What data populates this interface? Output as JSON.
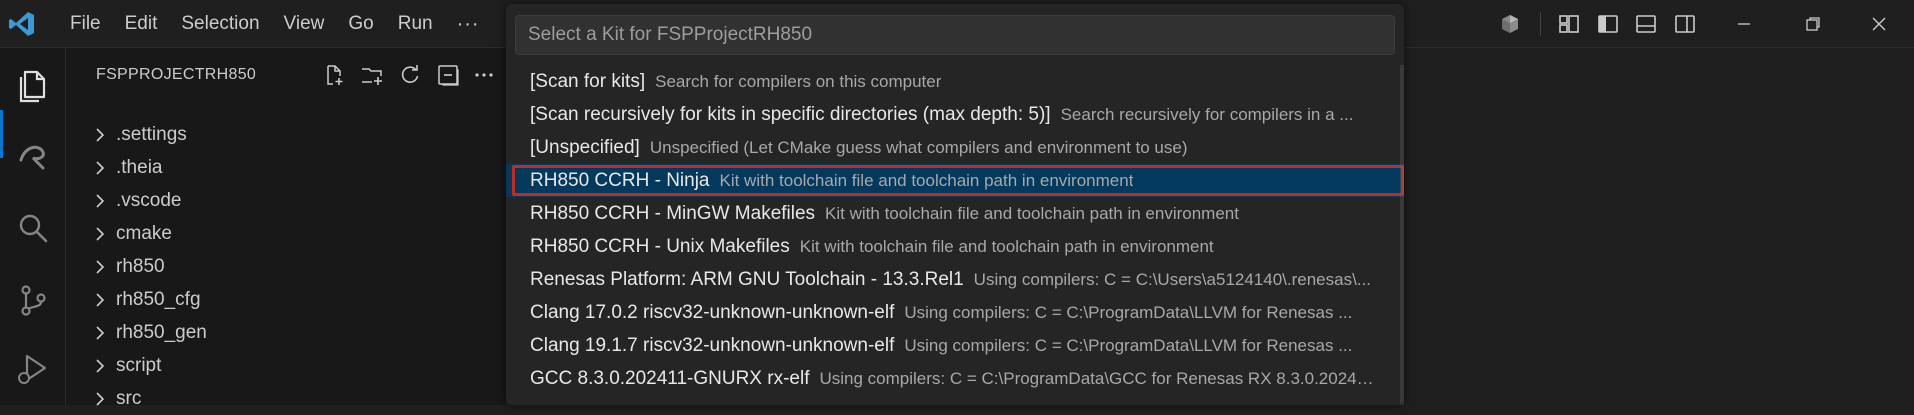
{
  "menu": [
    "File",
    "Edit",
    "Selection",
    "View",
    "Go",
    "Run",
    "···"
  ],
  "explorer": {
    "title": "FSPPROJECTRH850",
    "folders": [
      ".settings",
      ".theia",
      ".vscode",
      "cmake",
      "rh850",
      "rh850_cfg",
      "rh850_gen",
      "script",
      "src"
    ]
  },
  "quickpick": {
    "placeholder": "Select a Kit for FSPProjectRH850",
    "items": [
      {
        "label": "[Scan for kits]",
        "desc": "Search for compilers on this computer"
      },
      {
        "label": "[Scan recursively for kits in specific directories (max depth: 5)]",
        "desc": "Search recursively for compilers in a ..."
      },
      {
        "label": "[Unspecified]",
        "desc": "Unspecified (Let CMake guess what compilers and environment to use)"
      },
      {
        "label": "RH850 CCRH - Ninja",
        "desc": "Kit with toolchain file and toolchain path in environment"
      },
      {
        "label": "RH850 CCRH - MinGW Makefiles",
        "desc": "Kit with toolchain file and toolchain path in environment"
      },
      {
        "label": "RH850 CCRH - Unix Makefiles",
        "desc": "Kit with toolchain file and toolchain path in environment"
      },
      {
        "label": "Renesas Platform: ARM GNU Toolchain - 13.3.Rel1",
        "desc": "Using compilers: C = C:\\Users\\a5124140\\.renesas\\..."
      },
      {
        "label": "Clang 17.0.2 riscv32-unknown-unknown-elf",
        "desc": "Using compilers: C = C:\\ProgramData\\LLVM for Renesas ..."
      },
      {
        "label": "Clang 19.1.7 riscv32-unknown-unknown-elf",
        "desc": "Using compilers: C = C:\\ProgramData\\LLVM for Renesas ..."
      },
      {
        "label": "GCC 8.3.0.202411-GNURX rx-elf",
        "desc": "Using compilers: C = C:\\ProgramData\\GCC for Renesas RX 8.3.0.20241..."
      }
    ],
    "selected_index": 3
  },
  "colors": {
    "accent": "#0078d4",
    "highlight_border": "#c42b1c",
    "selection_bg": "#04395e",
    "logo": "#3c99d4"
  },
  "icons": [
    "vscode-logo",
    "copilot-icon",
    "layout-icon",
    "sidebar-left-icon",
    "panel-icon",
    "sidebar-right-icon",
    "minimize-icon",
    "maximize-icon",
    "close-icon",
    "explorer-icon",
    "remote-explorer-icon",
    "search-icon",
    "source-control-icon",
    "run-debug-icon",
    "new-file-icon",
    "new-folder-icon",
    "refresh-icon",
    "collapse-all-icon",
    "more-actions-icon",
    "chevron-right-icon"
  ]
}
